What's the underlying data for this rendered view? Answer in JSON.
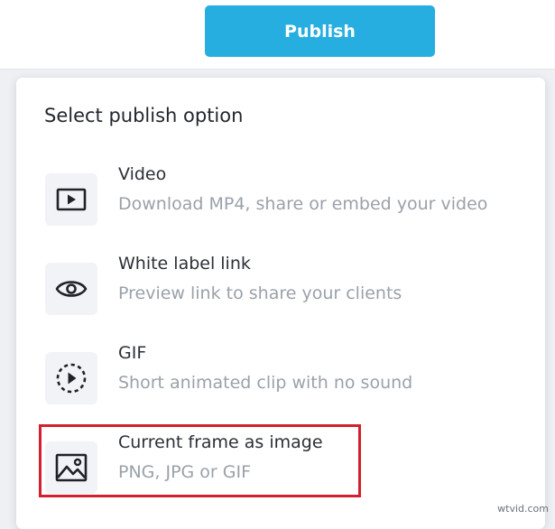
{
  "header": {
    "publish_label": "Publish"
  },
  "panel": {
    "title": "Select publish option",
    "options": [
      {
        "title": "Video",
        "description": "Download MP4, share or embed your video",
        "icon": "video-play-icon"
      },
      {
        "title": "White label link",
        "description": "Preview link to share your clients",
        "icon": "eye-icon"
      },
      {
        "title": "GIF",
        "description": "Short animated clip with no sound",
        "icon": "gif-dashed-play-icon"
      },
      {
        "title": "Current frame as image",
        "description": "PNG, JPG or GIF",
        "icon": "image-icon"
      }
    ]
  },
  "colors": {
    "accent": "#27aee0",
    "highlight": "#d3202e",
    "panel_bg": "#ffffff",
    "page_bg": "#eef0f3"
  },
  "watermark": "wtvid.com"
}
